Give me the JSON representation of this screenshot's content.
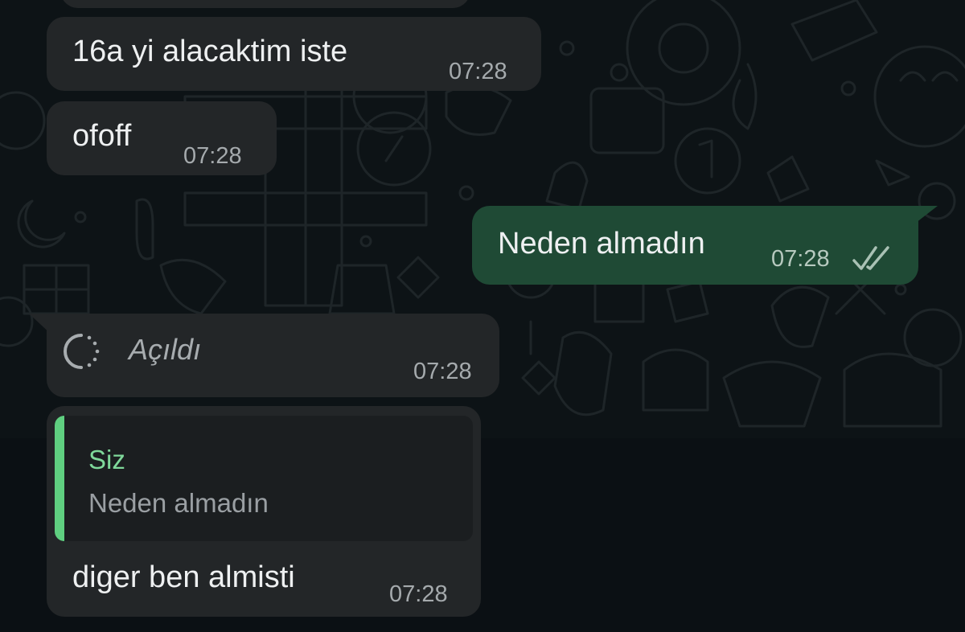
{
  "messages": [
    {
      "id": "m1",
      "direction": "in",
      "text": "16a yi alacaktim iste",
      "time": "07:28"
    },
    {
      "id": "m2",
      "direction": "in",
      "text": "ofoff",
      "time": "07:28"
    },
    {
      "id": "m3",
      "direction": "out",
      "text": "Neden almadın",
      "time": "07:28",
      "status_icon": "double-check-icon"
    },
    {
      "id": "m4",
      "direction": "in",
      "type": "view-once",
      "text": "Açıldı",
      "time": "07:28",
      "icon": "view-once-opened-icon"
    },
    {
      "id": "m5",
      "direction": "in",
      "quote": {
        "author": "Siz",
        "text": "Neden almadın"
      },
      "text": "diger ben almisti",
      "time": "07:28"
    }
  ],
  "colors": {
    "incoming_bubble": "#232628",
    "outgoing_bubble": "#1f4a35",
    "quote_accent": "#5fcf80",
    "quote_author": "#7fd89a"
  }
}
